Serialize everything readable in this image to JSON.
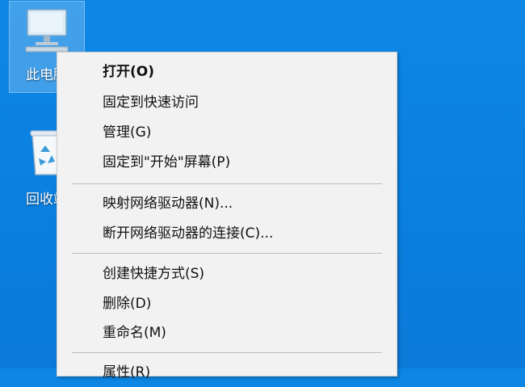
{
  "desktop": {
    "background_color": "#0d87e6",
    "icons": [
      {
        "label": "此电脑",
        "icon": "computer-icon",
        "selected": true
      },
      {
        "label": "回收站",
        "icon": "recycle-bin-icon",
        "selected": false
      }
    ]
  },
  "context_menu": {
    "groups": [
      {
        "items": [
          {
            "label": "打开(O)",
            "bold": true
          },
          {
            "label": "固定到快速访问",
            "bold": false
          },
          {
            "label": "管理(G)",
            "bold": false
          },
          {
            "label": "固定到\"开始\"屏幕(P)",
            "bold": false
          }
        ]
      },
      {
        "items": [
          {
            "label": "映射网络驱动器(N)...",
            "bold": false
          },
          {
            "label": "断开网络驱动器的连接(C)...",
            "bold": false
          }
        ]
      },
      {
        "items": [
          {
            "label": "创建快捷方式(S)",
            "bold": false
          },
          {
            "label": "删除(D)",
            "bold": false
          },
          {
            "label": "重命名(M)",
            "bold": false
          }
        ]
      },
      {
        "items": [
          {
            "label": "属性(R)",
            "bold": false
          }
        ]
      }
    ]
  }
}
